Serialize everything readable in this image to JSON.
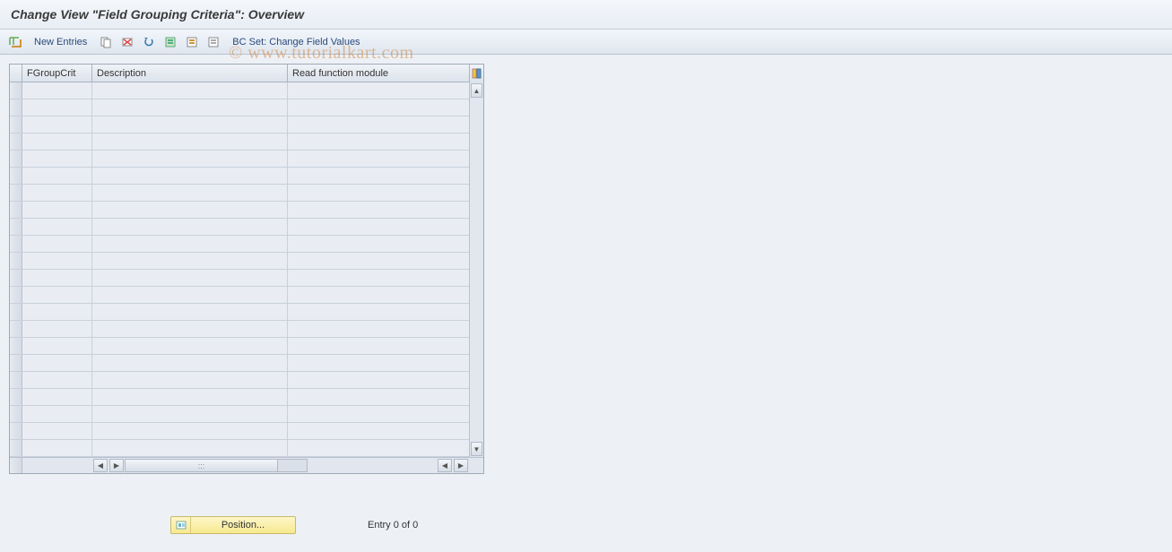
{
  "title": "Change View \"Field Grouping Criteria\": Overview",
  "toolbar": {
    "new_entries": "New Entries",
    "bc_set": "BC Set: Change Field Values"
  },
  "table": {
    "columns": {
      "fgroupcrit": "FGroupCrit",
      "description": "Description",
      "read_fn": "Read function module"
    },
    "row_count": 22
  },
  "footer": {
    "position_label": "Position...",
    "entry_status": "Entry 0 of 0"
  },
  "watermark": "© www.tutorialkart.com"
}
